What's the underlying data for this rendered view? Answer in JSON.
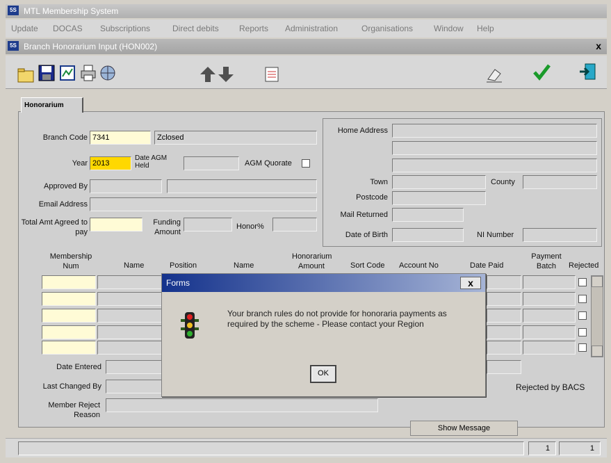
{
  "window": {
    "title": "MTL Membership System",
    "app_icon_label": "5S"
  },
  "menu": [
    "Update",
    "DOCAS",
    "Subscriptions",
    "Direct debits",
    "Reports",
    "Administration",
    "Organisations",
    "Window",
    "Help"
  ],
  "form": {
    "title": "Branch Honorarium Input (HON002)",
    "close_label": "x"
  },
  "tab": {
    "label": "Honorarium"
  },
  "fields": {
    "branch_code_label": "Branch Code",
    "branch_code": "7341",
    "branch_name": "Zclosed",
    "year_label": "Year",
    "year": "2013",
    "date_agm_label": "Date AGM Held",
    "agm_quorate_label": "AGM Quorate",
    "approved_by_label": "Approved By",
    "email_label": "Email Address",
    "total_amt_label": "Total Amt Agreed to pay",
    "funding_amount_label": "Funding Amount",
    "honor_pct_label": "Honor%"
  },
  "address": {
    "home_address_label": "Home Address",
    "town_label": "Town",
    "county_label": "County",
    "postcode_label": "Postcode",
    "mail_returned_label": "Mail Returned",
    "dob_label": "Date of Birth",
    "ni_label": "NI Number"
  },
  "table": {
    "headers": [
      "Membership Num",
      "Name",
      "Position",
      "Name",
      "Honorarium Amount",
      "Sort Code",
      "Account No",
      "Date Paid",
      "Payment Batch",
      "Rejected"
    ]
  },
  "lower": {
    "date_entered_label": "Date Entered",
    "last_changed_label": "Last Changed By",
    "member_reject_label": "Member Reject Reason",
    "rejected_bacs_label": "Rejected by BACS",
    "show_message_label": "Show Message"
  },
  "dialog": {
    "title": "Forms",
    "close_label": "x",
    "message": "Your branch rules do not provide for honoraria payments as required by the scheme - Please contact your Region",
    "ok_label": "OK"
  },
  "status": {
    "record": "1",
    "of": "1"
  }
}
